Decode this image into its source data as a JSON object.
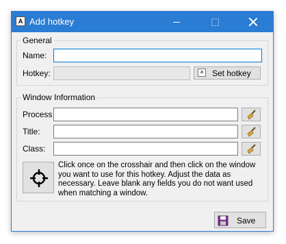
{
  "window": {
    "title": "Add hotkey",
    "app_icon_glyph": "A"
  },
  "general": {
    "legend": "General",
    "name_label": "Name:",
    "name_value": "",
    "hotkey_label": "Hotkey:",
    "hotkey_value": "",
    "set_hotkey_label": "Set hotkey",
    "set_hotkey_icon_glyph": "a"
  },
  "window_info": {
    "legend": "Window Information",
    "process_label": "Process",
    "process_value": "",
    "title_label": "Title:",
    "title_value": "",
    "class_label": "Class:",
    "class_value": "",
    "info_text": "Click once on the crosshair and then click on the window you want to use for this hotkey.  Adjust the data as necessary.  Leave blank any fields you do not want used when matching a window."
  },
  "footer": {
    "save_label": "Save"
  },
  "colors": {
    "titlebar": "#2b7cd3",
    "focus_border": "#0078d7",
    "window_bg": "#f0f0f0"
  },
  "icons": [
    "app-icon",
    "minimize-icon",
    "maximize-icon",
    "close-icon",
    "keyboard-icon",
    "broom-icon",
    "crosshair-icon",
    "floppy-disk-icon"
  ]
}
